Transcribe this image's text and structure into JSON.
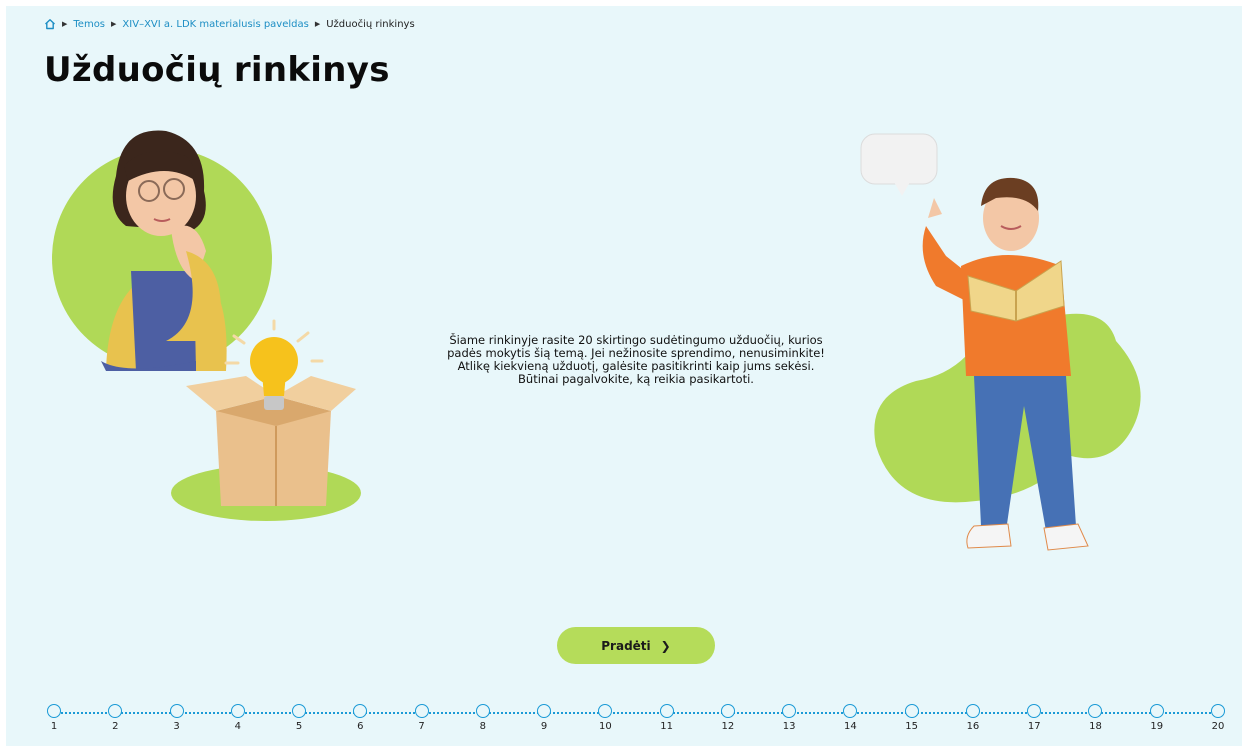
{
  "breadcrumb": {
    "items": [
      "Temos",
      "XIV–XVI a. LDK materialusis paveldas"
    ],
    "current": "Užduočių rinkinys"
  },
  "page_title": "Užduočių rinkinys",
  "intro_text": "Šiame rinkinyje rasite 20 skirtingo sudėtingumo užduočių, kurios padės mokytis šią temą. Jei nežinosite sprendimo, nenusiminkite! Atlikę kiekvieną užduotį, galėsite pasitikrinti kaip jums sekėsi. Būtinai pagalvokite, ką reikia pasikartoti.",
  "start_button": {
    "label": "Pradėti",
    "icon": "chevron-right-icon"
  },
  "steps": [
    "1",
    "2",
    "3",
    "4",
    "5",
    "6",
    "7",
    "8",
    "9",
    "10",
    "11",
    "12",
    "13",
    "14",
    "15",
    "16",
    "17",
    "18",
    "19",
    "20"
  ],
  "colors": {
    "background": "#e8f7fa",
    "accent_green": "#b5dc5a",
    "link_blue": "#1d8ec4",
    "stepper_blue": "#1a9ad6"
  },
  "icons": {
    "home": "home-icon",
    "separator": "caret-right-icon"
  }
}
